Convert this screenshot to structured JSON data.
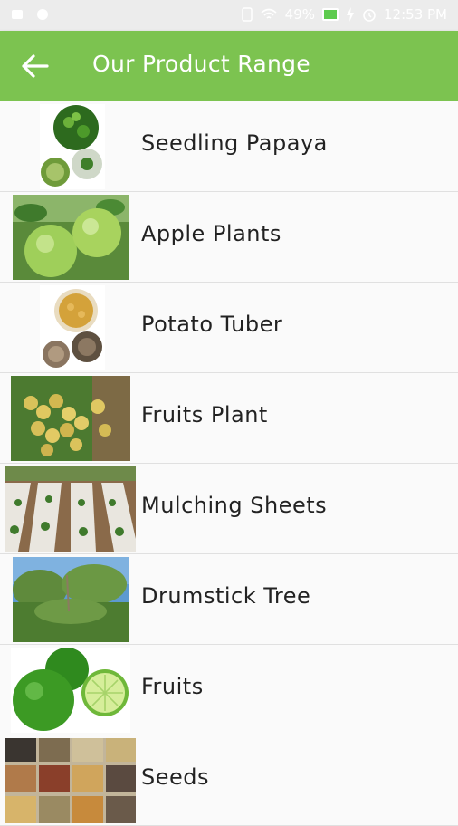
{
  "status_bar": {
    "battery_percent": "49%",
    "time": "12:53 PM",
    "icons": [
      "notification-icon",
      "notification-icon",
      "vibrate-icon",
      "wifi-icon",
      "battery-icon",
      "charging-icon",
      "alarm-icon"
    ]
  },
  "app_bar": {
    "title": "Our Product Range",
    "back_icon": "arrow-back-icon",
    "color": "#7cc350"
  },
  "products": [
    {
      "label": "Seedling Papaya",
      "image": "seedling-papaya-image"
    },
    {
      "label": "Apple Plants",
      "image": "apple-plants-image"
    },
    {
      "label": "Potato Tuber",
      "image": "potato-tuber-image"
    },
    {
      "label": "Fruits Plant",
      "image": "fruits-plant-image"
    },
    {
      "label": "Mulching Sheets",
      "image": "mulching-sheets-image"
    },
    {
      "label": "Drumstick Tree",
      "image": "drumstick-tree-image"
    },
    {
      "label": "Fruits",
      "image": "fruits-image"
    },
    {
      "label": "Seeds",
      "image": "seeds-image"
    }
  ]
}
